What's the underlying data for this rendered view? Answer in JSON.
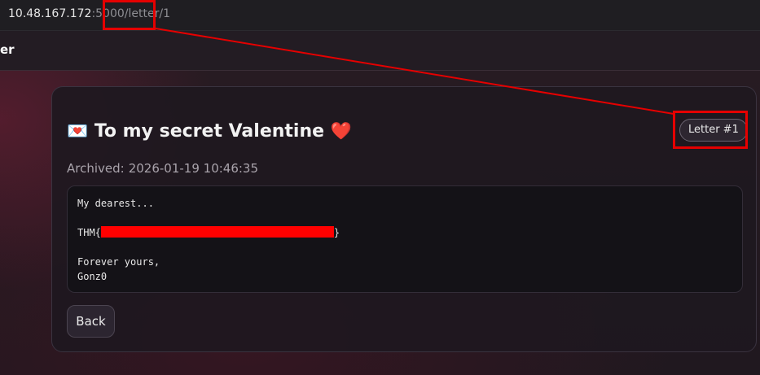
{
  "browser": {
    "url_host": "10.48.167.172",
    "url_port": ":5000",
    "url_path": "/letter/1"
  },
  "site": {
    "brand_fragment": "er"
  },
  "letter": {
    "title_icon": "💌",
    "title": "To my secret Valentine",
    "title_heart": "❤️",
    "badge": "Letter #1",
    "archived_label": "Archived:",
    "archived_time": "2026-01-19 10:46:35",
    "greeting": "My dearest...",
    "flag_prefix": "THM{",
    "flag_suffix": "}",
    "closing": "Forever yours,",
    "signature": "Gonz0",
    "back_label": "Back"
  },
  "annotation": {
    "color": "#e50000"
  }
}
